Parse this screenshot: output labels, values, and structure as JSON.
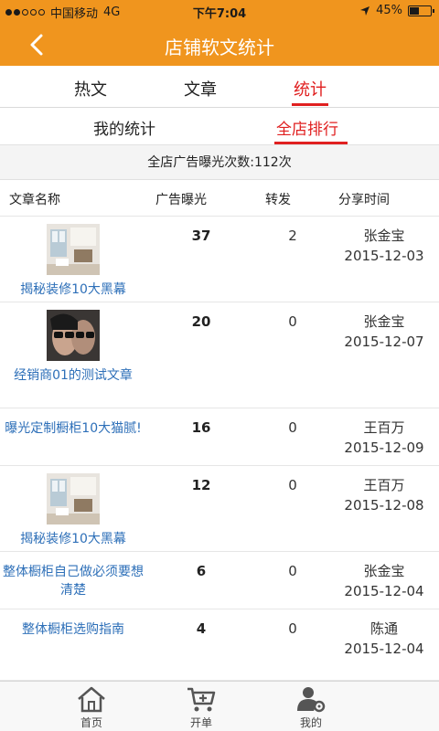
{
  "status_bar": {
    "carrier": "中国移动",
    "network": "4G",
    "time": "下午7:04",
    "battery": "45%",
    "battery_level": 0.45
  },
  "header": {
    "title": "店铺软文统计",
    "back_icon": "chevron-left-icon"
  },
  "top_tabs": [
    {
      "label": "热文"
    },
    {
      "label": "文章"
    },
    {
      "label": "统计"
    }
  ],
  "top_tabs_active": 2,
  "sub_tabs": [
    {
      "label": "我的统计"
    },
    {
      "label": "全店排行"
    }
  ],
  "sub_tabs_active": 1,
  "summary": "全店广告曝光次数:112次",
  "table": {
    "headers": {
      "name": "文章名称",
      "exposure": "广告曝光",
      "forward": "转发",
      "share_time": "分享时间"
    },
    "rows": [
      {
        "title": "揭秘装修10大黑幕",
        "thumb": "room-photo",
        "exposure": "37",
        "forward": "2",
        "sharer": "张金宝",
        "date": "2015-12-03"
      },
      {
        "title": "经销商01的测试文章",
        "thumb": "sunglasses-photo",
        "exposure": "20",
        "forward": "0",
        "sharer": "张金宝",
        "date": "2015-12-07"
      },
      {
        "title": "曝光定制橱柜10大猫腻!",
        "thumb": "",
        "exposure": "16",
        "forward": "0",
        "sharer": "王百万",
        "date": "2015-12-09"
      },
      {
        "title": "揭秘装修10大黑幕",
        "thumb": "room-photo",
        "exposure": "12",
        "forward": "0",
        "sharer": "王百万",
        "date": "2015-12-08"
      },
      {
        "title": "整体橱柜自己做必须要想清楚",
        "thumb": "",
        "exposure": "6",
        "forward": "0",
        "sharer": "张金宝",
        "date": "2015-12-04"
      },
      {
        "title": "整体橱柜选购指南",
        "thumb": "",
        "exposure": "4",
        "forward": "0",
        "sharer": "陈通",
        "date": "2015-12-04"
      }
    ]
  },
  "tab_bar": [
    {
      "label": "首页",
      "icon": "home-icon"
    },
    {
      "label": "开单",
      "icon": "cart-icon"
    },
    {
      "label": "我的",
      "icon": "user-gear-icon"
    }
  ],
  "colors": {
    "accent": "#f0951e",
    "active_tab": "#e02020",
    "link": "#2d6fb8"
  }
}
